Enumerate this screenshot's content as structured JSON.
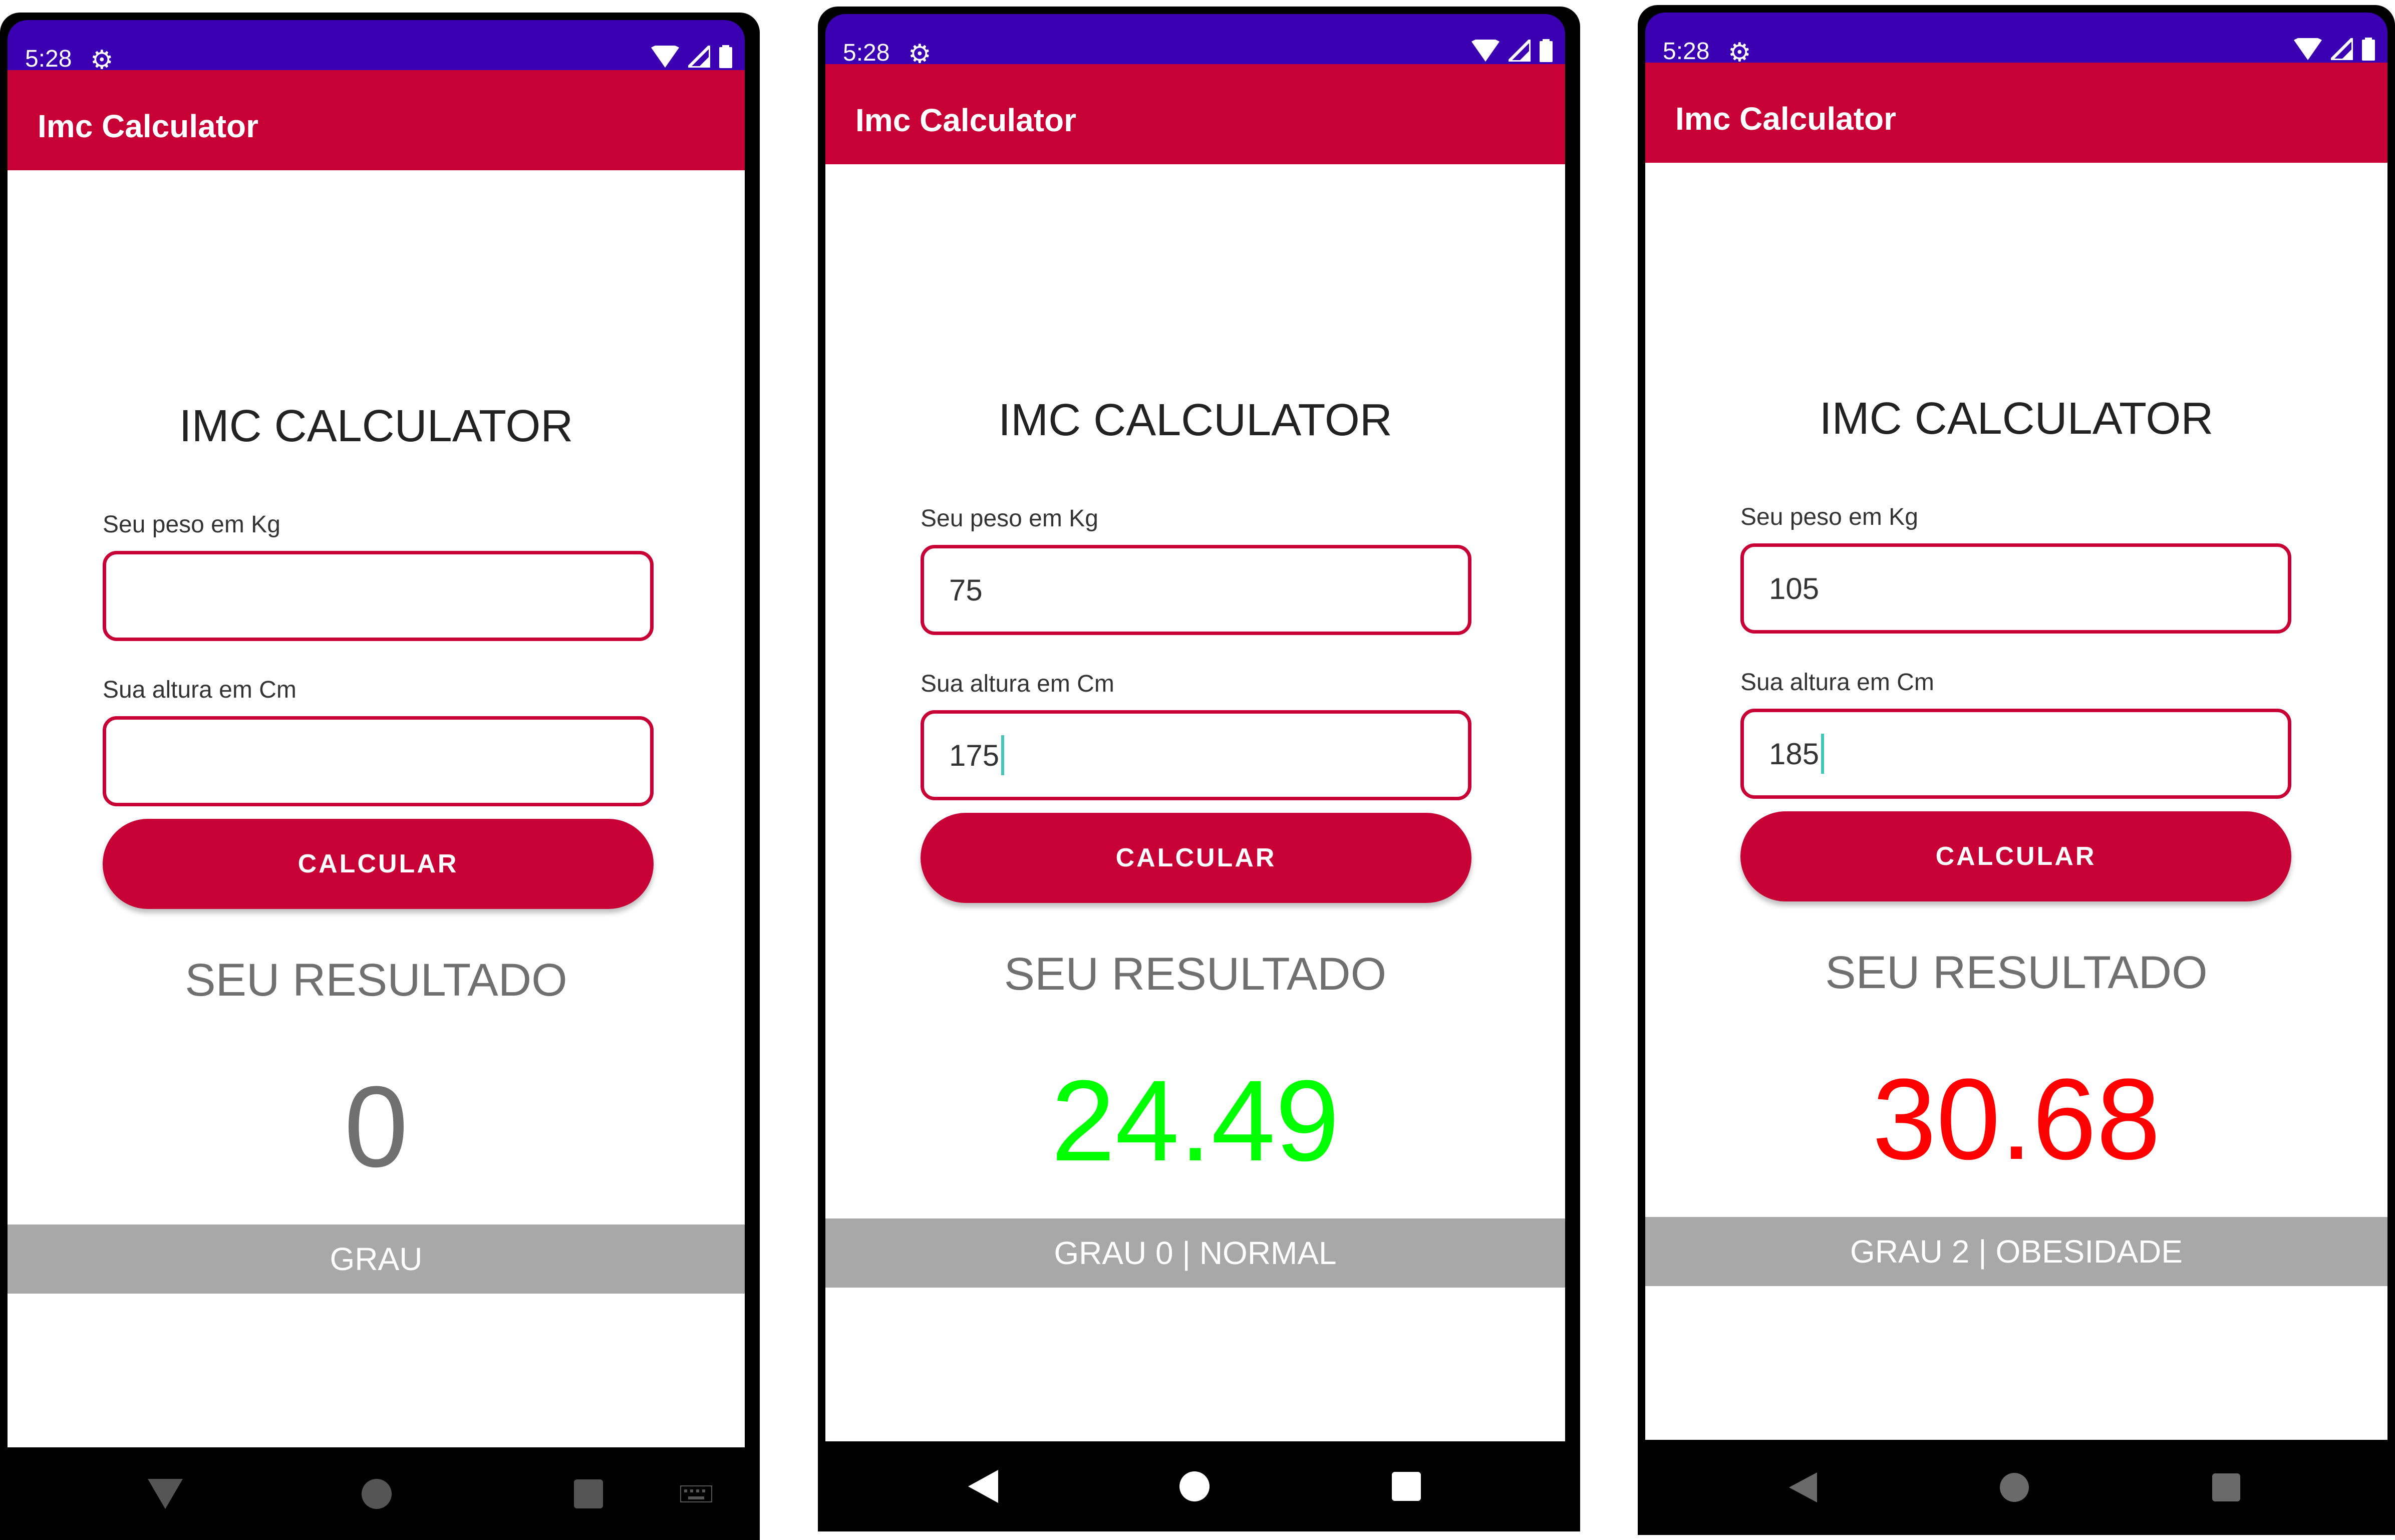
{
  "screens": [
    {
      "status_time": "5:28",
      "app_title": "Imc Calculator",
      "heading": "IMC CALCULATOR",
      "weight_label": "Seu peso em Kg",
      "weight_value": "",
      "height_label": "Sua altura em Cm",
      "height_value": "",
      "button_label": "CALCULAR",
      "result_label": "SEU RESULTADO",
      "result_value": "0",
      "result_color": "#707070",
      "grade": "GRAU"
    },
    {
      "status_time": "5:28",
      "app_title": "Imc Calculator",
      "heading": "IMC CALCULATOR",
      "weight_label": "Seu peso em Kg",
      "weight_value": "75",
      "height_label": "Sua altura em Cm",
      "height_value": "175",
      "button_label": "CALCULAR",
      "result_label": "SEU RESULTADO",
      "result_value": "24.49",
      "result_color": "#00ff00",
      "grade": "GRAU 0 | NORMAL"
    },
    {
      "status_time": "5:28",
      "app_title": "Imc Calculator",
      "heading": "IMC CALCULATOR",
      "weight_label": "Seu peso em Kg",
      "weight_value": "105",
      "height_label": "Sua altura em Cm",
      "height_value": "185",
      "button_label": "CALCULAR",
      "result_label": "SEU RESULTADO",
      "result_value": "30.68",
      "result_color": "#ff0000",
      "grade": "GRAU 2 | OBESIDADE"
    }
  ],
  "colors": {
    "status_bar": "#3a00b2",
    "app_bar": "#c70136",
    "accent": "#c70136",
    "grade_bar": "#a8a8a8"
  },
  "icons": [
    "gear-icon",
    "wifi-icon",
    "signal-icon",
    "battery-icon",
    "back-icon",
    "home-icon",
    "recents-icon",
    "keyboard-icon"
  ]
}
